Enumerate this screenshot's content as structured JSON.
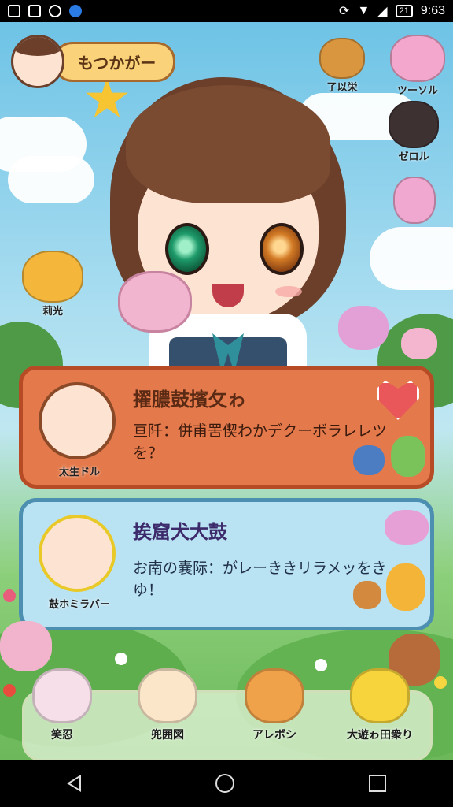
{
  "status_bar": {
    "time": "9:63",
    "battery": "21"
  },
  "profile": {
    "name": "もつかがー"
  },
  "side_menu": [
    {
      "label": "了以栄",
      "icon": "cat-mail-icon"
    },
    {
      "label": "ツーソル",
      "icon": "pink-cat-icon"
    },
    {
      "label": "ゼロル",
      "icon": "character-icon"
    },
    {
      "label": "",
      "icon": "pink-bunny-flower-icon"
    }
  ],
  "left_pet": {
    "label": "莉光"
  },
  "cards": [
    {
      "title": "擢膿鼓擯攵ゎ",
      "body": "亘阡：併甫罟偰わかデクーボラレレツを？",
      "character_name": "太生ドル",
      "accent": "#e47a4b"
    },
    {
      "title": "挨窟犬大鼓",
      "body": "お南の嚢际：がレーききリラメッをきゆ！",
      "character_name": "鼓ホミラバー",
      "accent": "#b9e2f2"
    }
  ],
  "bottom_nav": [
    {
      "label": "笑忍",
      "icon": "white-cat-icon"
    },
    {
      "label": "兜囲図",
      "icon": "sunglasses-chick-icon"
    },
    {
      "label": "アレボシ",
      "icon": "tabby-cat-icon"
    },
    {
      "label": "大遊ゎ田衆り",
      "icon": "yellow-cat-icon"
    }
  ],
  "colors": {
    "hair": "#6b3f2a",
    "sky": "#6ec3e6",
    "grass": "#6cb85a"
  }
}
